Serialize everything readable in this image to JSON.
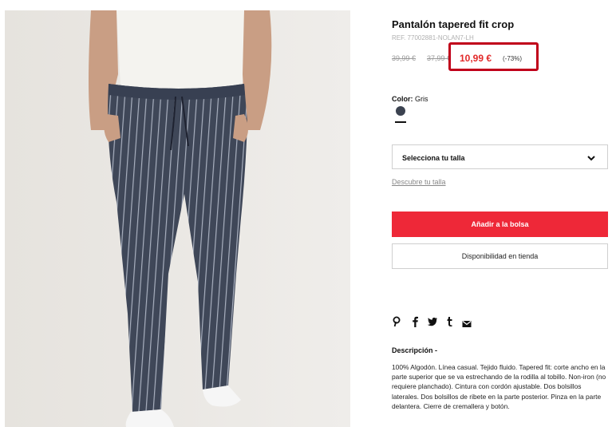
{
  "product": {
    "title": "Pantalón tapered fit crop",
    "ref": "REF. 77002881-NOLAN7-LH",
    "old_price_1": "39,99 €",
    "old_price_2": "37,99 €",
    "price": "10,99 €",
    "discount": "(-73%)",
    "image_alt": "Pantalón gris a rayas"
  },
  "color": {
    "label": "Color:",
    "value": "Gris",
    "swatch_color": "#3b4250"
  },
  "size": {
    "select_label": "Selecciona tu talla",
    "guide_link": "Descubre tu talla"
  },
  "actions": {
    "add_to_bag": "Añadir a la bolsa",
    "store_availability": "Disponibilidad en tienda"
  },
  "share_icons": [
    "pinterest-icon",
    "facebook-icon",
    "twitter-icon",
    "tumblr-icon",
    "email-icon"
  ],
  "description": {
    "title": "Descripción -",
    "text": "100% Algodón. Línea casual. Tejido fluido. Tapered fit: corte ancho en la parte superior que se va estrechando de la rodilla al tobillo. Non-iron (no requiere planchado). Cintura con cordón ajustable. Dos bolsillos laterales. Dos bolsillos de ribete en la parte posterior. Pinza en la parte delantera. Cierre de cremallera y botón."
  },
  "colors": {
    "accent_red": "#ee2838",
    "highlight_border": "#c0001a",
    "sale_price": "#e22a2a"
  }
}
